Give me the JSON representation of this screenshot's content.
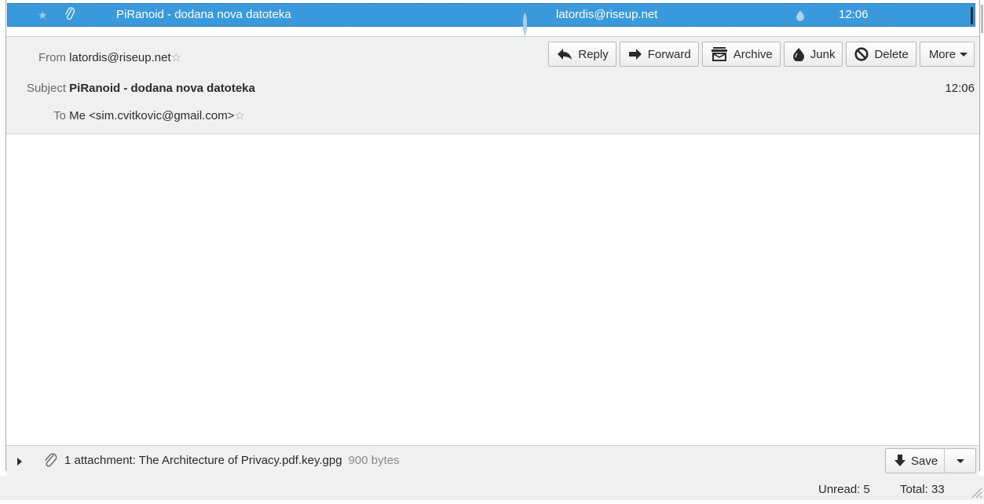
{
  "message_list": {
    "selected_row": {
      "subject": "PiRanoid - dodana nova datoteka",
      "correspondent": "latordis@riseup.net",
      "date": "12:06"
    }
  },
  "header": {
    "from_label": "From",
    "from_value": "latordis@riseup.net",
    "subject_label": "Subject",
    "subject_value": "PiRanoid - dodana nova datoteka",
    "to_label": "To",
    "to_value": "Me <sim.cvitkovic@gmail.com>",
    "date": "12:06"
  },
  "toolbar": {
    "reply_label": "Reply",
    "forward_label": "Forward",
    "archive_label": "Archive",
    "junk_label": "Junk",
    "delete_label": "Delete",
    "more_label": "More"
  },
  "attachments": {
    "summary_label": "1 attachment:",
    "filename": "The Architecture of Privacy.pdf.key.gpg",
    "size": "900 bytes",
    "save_label": "Save"
  },
  "status": {
    "unread": "Unread: 5",
    "total": "Total: 33"
  },
  "colors": {
    "selection": "#3a99da",
    "header_bg": "#f0f0f0"
  }
}
